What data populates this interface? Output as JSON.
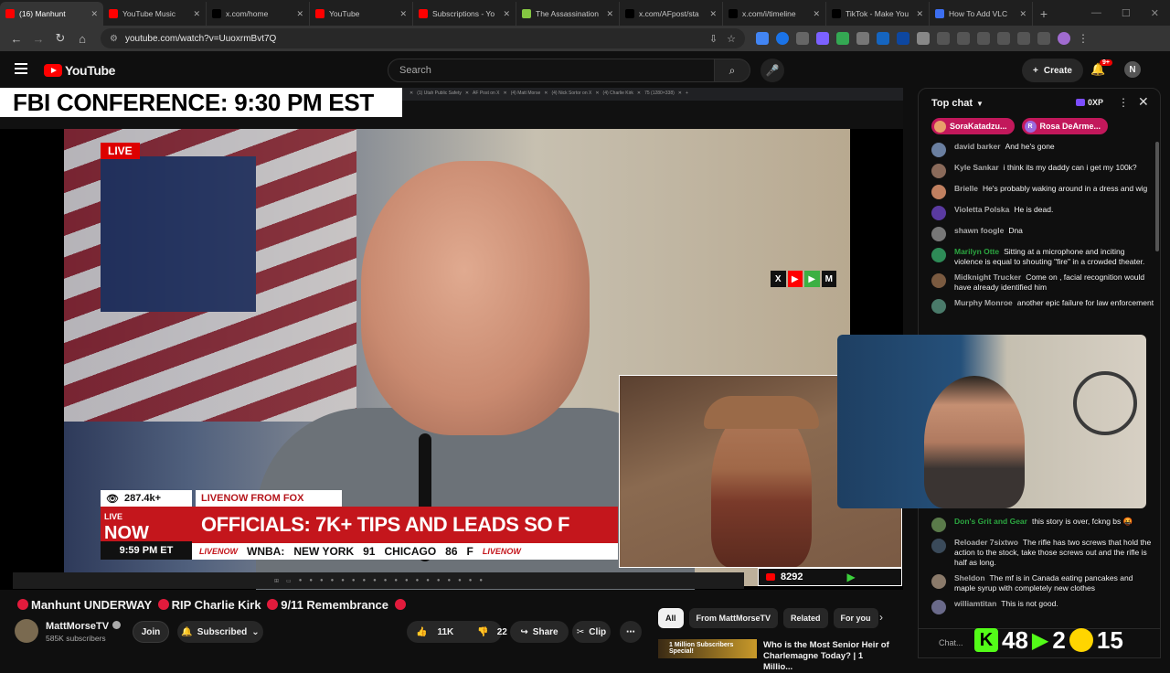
{
  "browser": {
    "tabs": [
      {
        "title": "(16) Manhunt",
        "icon": "youtube-icon",
        "color": "#ff0000",
        "active": true
      },
      {
        "title": "YouTube Music",
        "icon": "youtube-music-icon",
        "color": "#ff0000"
      },
      {
        "title": "x.com/home",
        "icon": "x-icon",
        "color": "#000000"
      },
      {
        "title": "YouTube",
        "icon": "youtube-icon",
        "color": "#ff0000"
      },
      {
        "title": "Subscriptions - Yo",
        "icon": "youtube-icon",
        "color": "#ff0000"
      },
      {
        "title": "The Assassination",
        "icon": "rumble-icon",
        "color": "#85c742"
      },
      {
        "title": "x.com/AFpost/sta",
        "icon": "x-icon",
        "color": "#000000"
      },
      {
        "title": "x.com/i/timeline",
        "icon": "x-icon",
        "color": "#000000"
      },
      {
        "title": "TikTok - Make You",
        "icon": "tiktok-icon",
        "color": "#000000"
      },
      {
        "title": "How To Add VLC",
        "icon": "help-icon",
        "color": "#3c6ef0"
      }
    ],
    "url": "youtube.com/watch?v=UuoxrmBvt7Q"
  },
  "youtube": {
    "logo_text": "YouTube",
    "search_placeholder": "Search",
    "create_label": "Create",
    "notif_badge": "9+",
    "avatar_initial": "N"
  },
  "stream": {
    "headline": "FBI CONFERENCE: 9:30 PM EST",
    "live_label": "LIVE",
    "viewers": "287.4k+",
    "network_tag": "LIVENOW FROM FOX",
    "livenow_logo_top": "LIVE",
    "livenow_logo_bottom": "NOW",
    "time": "9:59 PM ET",
    "ticker": "OFFICIALS: 7K+ TIPS AND LEADS SO F",
    "scores": {
      "league": "WNBA:",
      "team1": "NEW YORK",
      "score1": "91",
      "team2": "CHICAGO",
      "score2": "86",
      "trail": "F"
    },
    "livenow_small": "LIVENOW",
    "yt_viewer_count": "8292"
  },
  "video": {
    "title_parts": [
      "Manhunt UNDERWAY",
      "RIP Charlie Kirk",
      "9/11 Remembrance"
    ],
    "channel": "MattMorseTV",
    "subscribers": "585K subscribers",
    "join_label": "Join",
    "subscribed_label": "Subscribed",
    "likes": "11K",
    "dislikes": "22",
    "share_label": "Share",
    "clip_label": "Clip"
  },
  "recommendations": {
    "chips": [
      "All",
      "From MattMorseTV",
      "Related",
      "For you"
    ],
    "first_thumb_text": "1 Million Subscribers Special!",
    "first_title": "Who is the Most Senior Heir of Charlemagne Today? | 1 Millio..."
  },
  "chat": {
    "mode": "Top chat",
    "xp": "0XP",
    "pinned": [
      {
        "name": "SoraKatadzu...",
        "initial": ""
      },
      {
        "name": "Rosa DeArme...",
        "initial": "R"
      }
    ],
    "messages": [
      {
        "author": "david barker",
        "text": "And he's gone",
        "color": "#6a7fa0"
      },
      {
        "author": "Kyle Sankar",
        "text": "i think its my daddy can i get my 100k?",
        "color": "#8a6a5a"
      },
      {
        "author": "Brielle",
        "text": "He's probably waking around in a dress and wig",
        "color": "#c08060"
      },
      {
        "author": "Violetta Polska",
        "text": "He is dead.",
        "color": "#5a3aa0"
      },
      {
        "author": "shawn foogle",
        "text": "Dna",
        "color": "#777777"
      },
      {
        "author": "Marilyn Otte",
        "text": "Sitting at a microphone and inciting violence is equal to shouting \"fire\" in a crowded theater.",
        "color": "#2e8b57",
        "initial": "M"
      },
      {
        "author": "Midknight Trucker",
        "text": "Come on , facial recognition would have already identified him",
        "color": "#7a5a40"
      },
      {
        "author": "Murphy Monroe",
        "text": "another epic failure for law enforcement",
        "color": "#4a7a6a"
      }
    ],
    "messages_lower": [
      {
        "author": "Don's Grit and Gear",
        "text": "this story is over, fckng bs 🤬",
        "color": "#5a7a4a",
        "member": true
      },
      {
        "author": "Reloader 7sixtwo",
        "text": "The rifle has two screws that hold the action to the stock, take those screws out and the rifle is half as long.",
        "color": "#3a4a5a"
      },
      {
        "author": "Sheldon",
        "text": "The mf is in Canada eating pancakes and maple syrup with completely new clothes",
        "color": "#8a7a6a"
      },
      {
        "author": "williamtitan",
        "text": "This is not good.",
        "color": "#6a6a8a"
      }
    ],
    "input_placeholder": "Chat..."
  },
  "overlay": {
    "k_label": "K",
    "n1": "48",
    "n2": "2",
    "n3": "15"
  }
}
